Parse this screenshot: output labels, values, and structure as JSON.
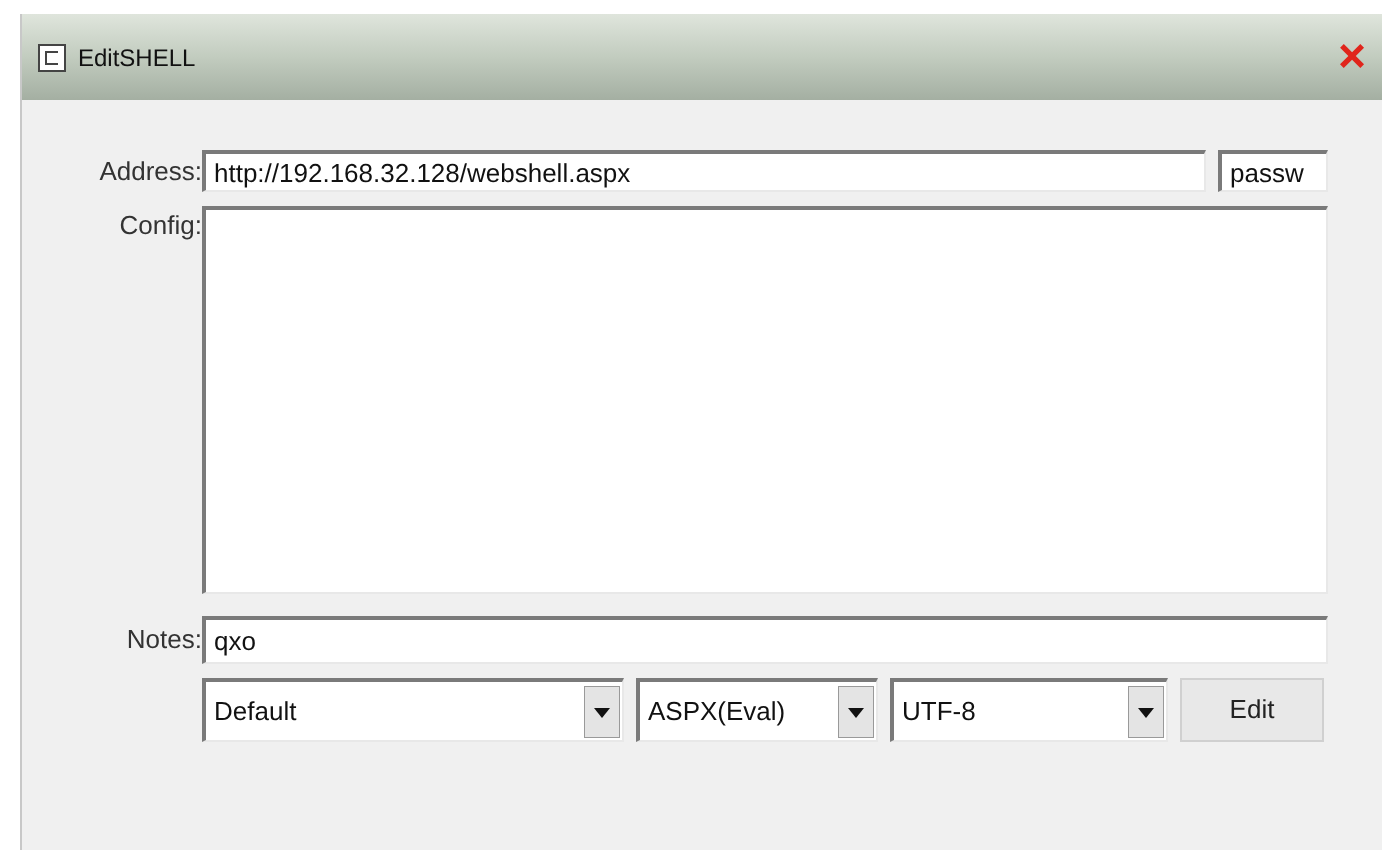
{
  "window": {
    "title": "EditSHELL",
    "close": "×"
  },
  "address": {
    "label": "Address:",
    "value": "http://192.168.32.128/webshell.aspx",
    "password": "passw"
  },
  "config": {
    "label": "Config:"
  },
  "notes": {
    "label": "Notes:",
    "value": "qxo"
  },
  "dropdowns": [
    {
      "value": "Default"
    },
    {
      "value": "ASPX(Eval)"
    },
    {
      "value": "UTF-8"
    }
  ],
  "buttons": [
    "Edit"
  ]
}
